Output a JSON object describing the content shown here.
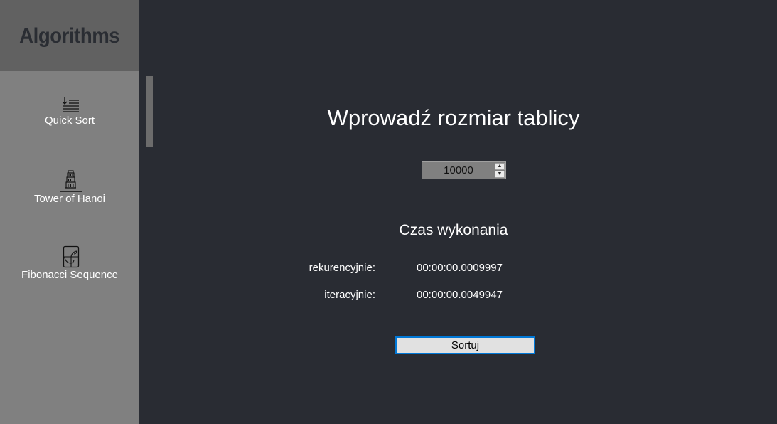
{
  "sidebar": {
    "logo": "Algorithms",
    "items": [
      {
        "label": "Quick Sort",
        "icon": "sort-list-icon"
      },
      {
        "label": "Tower of Hanoi",
        "icon": "tower-icon"
      },
      {
        "label": "Fibonacci Sequence",
        "icon": "fibonacci-spiral-icon"
      }
    ]
  },
  "main": {
    "title": "Wprowadź rozmiar tablicy",
    "array_size": "10000",
    "execution_title": "Czas wykonania",
    "recursive_label": "rekurencyjnie:",
    "recursive_time": "00:00:00.0009997",
    "iterative_label": "iteracyjnie:",
    "iterative_time": "00:00:00.0049947",
    "sort_button": "Sortuj"
  },
  "colors": {
    "background": "#292c33",
    "sidebar": "#808080",
    "logo_bg": "#616161",
    "accent": "#0078d7"
  }
}
